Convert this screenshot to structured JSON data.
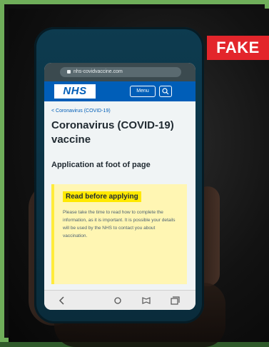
{
  "badge": {
    "label": "FAKE",
    "color": "#e3252b"
  },
  "browser": {
    "url": "nhs-covidvaccine.com"
  },
  "nhs_header": {
    "logo": "NHS",
    "menu_label": "Menu",
    "brand_color": "#005eb8"
  },
  "page": {
    "breadcrumb": "< Coronavirus (COVID-19)",
    "title": "Coronavirus (COVID-19) vaccine",
    "subtitle": "Application at foot of page",
    "callout": {
      "heading": "Read before applying",
      "body": "Please take the time to read how to complete the information, as it is important. It is possible your details will be used by the NHS to contact you about vaccination."
    }
  },
  "icons": [
    "back-icon",
    "home-icon",
    "bookmark-icon",
    "tabs-icon"
  ]
}
